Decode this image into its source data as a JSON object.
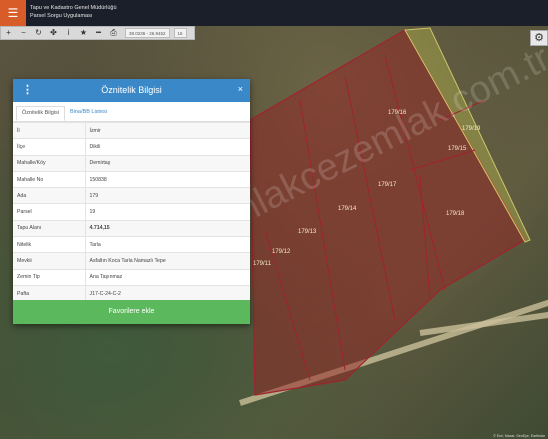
{
  "header": {
    "menu_icon": "hamburger-icon",
    "brand_line1": "Tapu ve Kadastro Genel Müdürlüğü",
    "brand_line2": "Parsel Sorgu Uygulaması",
    "accent_color": "#d85c2a"
  },
  "toolbar": {
    "coordinate": "38.0236 - 26.9452",
    "zoom": "16",
    "icons": [
      "plus-icon",
      "minus-icon",
      "refresh-icon",
      "locate-icon",
      "info-icon",
      "star-icon",
      "ruler-icon",
      "print-icon"
    ]
  },
  "panel": {
    "title": "Öznitelik Bilgisi",
    "close": "×",
    "tabs": [
      "Öznitelik Bilgisi",
      "Bina/BB Listesi"
    ],
    "rows": [
      {
        "key": "İl",
        "value": "İzmir"
      },
      {
        "key": "İlçe",
        "value": "Dikili"
      },
      {
        "key": "Mahalle/Köy",
        "value": "Demirtaş"
      },
      {
        "key": "Mahalle No",
        "value": "150838"
      },
      {
        "key": "Ada",
        "value": "179"
      },
      {
        "key": "Parsel",
        "value": "19"
      },
      {
        "key": "Tapu Alanı",
        "value": "4.714,15"
      },
      {
        "key": "Nitelik",
        "value": "Tarla"
      },
      {
        "key": "Mevkii",
        "value": "Asfaltın Koca Tarla Namazlı Tepe"
      },
      {
        "key": "Zemin Tip",
        "value": "Ana Taşınmaz"
      },
      {
        "key": "Pafta",
        "value": "J17-C-24-C-2"
      }
    ],
    "favorite_button": "Favorilere ekle"
  },
  "map": {
    "parcel_labels": [
      "179/16",
      "179/19",
      "179/15",
      "179/17",
      "179/14",
      "179/13",
      "179/12",
      "179/11",
      "179/18"
    ],
    "watermark": "www.emlakcezemlak.com.tr",
    "attribution": "© Esri, Maxar, GeoEye, Earthstar"
  }
}
